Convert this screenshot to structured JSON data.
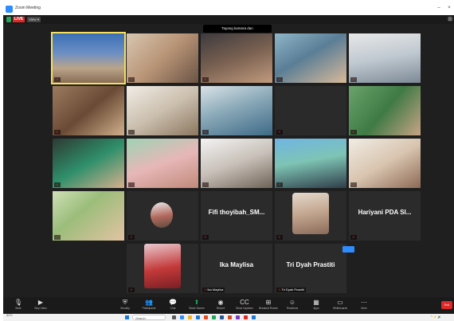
{
  "window": {
    "title": "Zoom Meeting",
    "minimize": "–",
    "close": "×"
  },
  "topbar": {
    "live_badge": "LIVE",
    "view_label": "View ▾"
  },
  "banner": "Tayang kamera dan",
  "participants": [
    {
      "name": ""
    },
    {
      "name": ""
    },
    {
      "name": ""
    },
    {
      "name": ""
    },
    {
      "name": ""
    },
    {
      "name": ""
    },
    {
      "name": ""
    },
    {
      "name": ""
    },
    {
      "name": ""
    },
    {
      "name": ""
    },
    {
      "name": ""
    },
    {
      "name": ""
    },
    {
      "name": ""
    },
    {
      "name": ""
    },
    {
      "name": ""
    },
    {
      "name": ""
    },
    {
      "name": ""
    },
    {
      "name": ""
    },
    {
      "name": "Fifi thoyibah_SM...",
      "label": ""
    },
    {
      "name": ""
    },
    {
      "name": "Hariyani PDA SI...",
      "label": ""
    },
    {
      "name": ""
    },
    {
      "name": "Ika Maylisa",
      "label": "Ika Maylisa"
    },
    {
      "name": "Tri Dyah Prastiti",
      "label": "Tri Dyah Prastiti"
    }
  ],
  "controls": {
    "mute": "Mute",
    "video": "Stop Video",
    "security": "Security",
    "participants": "Participants",
    "chat": "Chat",
    "share": "Share Screen",
    "record": "Record",
    "show_captions": "Show Captions",
    "breakout": "Breakout Rooms",
    "reactions": "Reactions",
    "apps": "Apps",
    "whiteboards": "Whiteboards",
    "more": "More",
    "end": "End"
  },
  "taskbar": {
    "weather_temp": "31°C",
    "search_label": "Search",
    "time": "",
    "date": ""
  }
}
